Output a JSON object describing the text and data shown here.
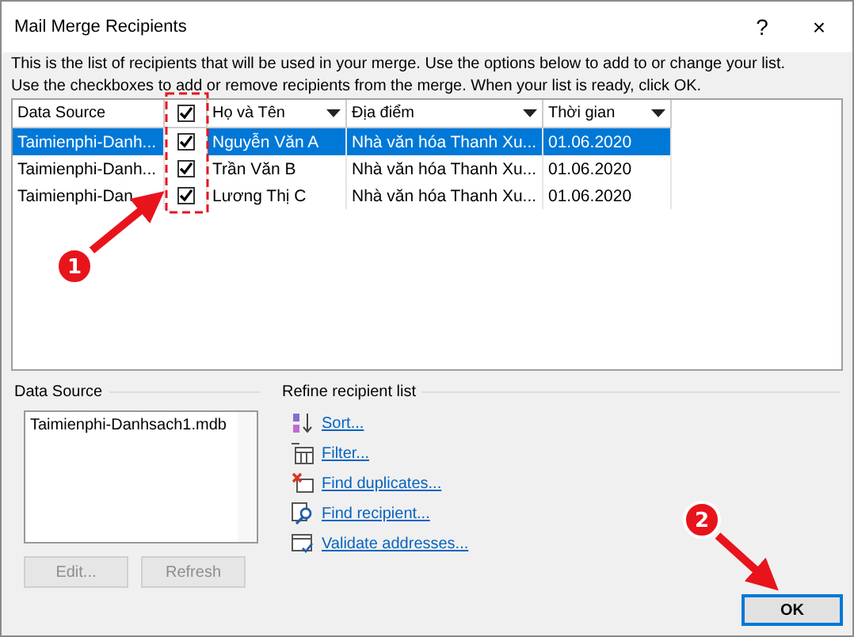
{
  "window": {
    "title": "Mail Merge Recipients",
    "help": "?",
    "close": "×"
  },
  "intro": [
    "This is the list of recipients that will be used in your merge.  Use the options below to add to or change your list.",
    "Use the checkboxes to add or remove recipients from the merge.  When your list is ready, click OK."
  ],
  "table": {
    "columns": [
      {
        "label": "Data Source",
        "dropdown": false
      },
      {
        "kind": "check",
        "checked": true
      },
      {
        "label": "Họ và Tên",
        "dropdown": true
      },
      {
        "label": "Địa điểm",
        "dropdown": true
      },
      {
        "label": "Thời gian",
        "dropdown": true
      }
    ],
    "rows": [
      {
        "selected": true,
        "source": "Taimienphi-Danh...",
        "checked": true,
        "name": "Nguyễn Văn A",
        "place": "Nhà văn hóa Thanh Xu...",
        "time": "01.06.2020"
      },
      {
        "selected": false,
        "source": "Taimienphi-Danh...",
        "checked": true,
        "name": "Trần Văn B",
        "place": "Nhà văn hóa Thanh Xu...",
        "time": "01.06.2020"
      },
      {
        "selected": false,
        "source": "Taimienphi-Dan",
        "checked": true,
        "name": "Lương Thị C",
        "place": "Nhà văn hóa Thanh Xu...",
        "time": "01.06.2020"
      }
    ]
  },
  "data_source": {
    "title": "Data Source",
    "items": [
      "Taimienphi-Danhsach1.mdb"
    ],
    "buttons": [
      {
        "label": "Edit...",
        "disabled": true
      },
      {
        "label": "Refresh",
        "disabled": true
      }
    ]
  },
  "refine": {
    "title": "Refine recipient list",
    "links": [
      {
        "kind": "sort",
        "label": "Sort..."
      },
      {
        "kind": "filter",
        "label": "Filter..."
      },
      {
        "kind": "duplicates",
        "label": "Find duplicates..."
      },
      {
        "kind": "find",
        "label": "Find recipient..."
      },
      {
        "kind": "validate",
        "label": "Validate addresses..."
      }
    ]
  },
  "ok_button": "OK",
  "annotations": [
    {
      "number": "1"
    },
    {
      "number": "2"
    }
  ]
}
